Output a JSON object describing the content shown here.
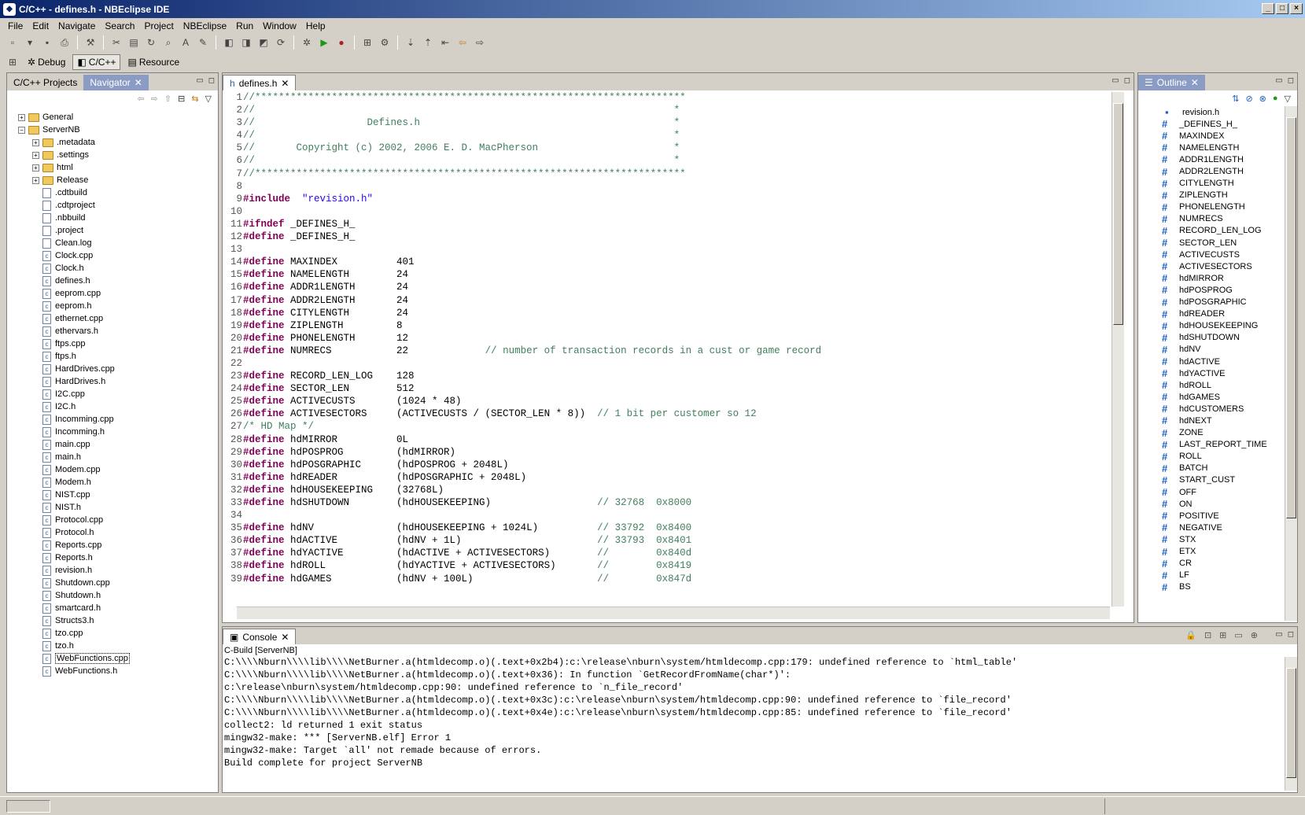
{
  "window": {
    "title": "C/C++ - defines.h - NBEclipse IDE"
  },
  "menu": [
    "File",
    "Edit",
    "Navigate",
    "Search",
    "Project",
    "NBEclipse",
    "Run",
    "Window",
    "Help"
  ],
  "perspectives": [
    {
      "label": "Debug",
      "icon": "bug-icon"
    },
    {
      "label": "C/C++",
      "icon": "cpp-icon",
      "active": true
    },
    {
      "label": "Resource",
      "icon": "folder-icon"
    }
  ],
  "navigator": {
    "tabs": [
      {
        "label": "C/C++ Projects"
      },
      {
        "label": "Navigator",
        "active": true
      }
    ],
    "tree": [
      {
        "label": "General",
        "type": "project",
        "level": 0,
        "expander": "+"
      },
      {
        "label": "ServerNB",
        "type": "project",
        "level": 0,
        "expander": "-"
      },
      {
        "label": ".metadata",
        "type": "folder",
        "level": 1,
        "expander": "+"
      },
      {
        "label": ".settings",
        "type": "folder",
        "level": 1,
        "expander": "+"
      },
      {
        "label": "html",
        "type": "folder",
        "level": 1,
        "expander": "+"
      },
      {
        "label": "Release",
        "type": "folder",
        "level": 1,
        "expander": "+"
      },
      {
        "label": ".cdtbuild",
        "type": "file",
        "level": 1
      },
      {
        "label": ".cdtproject",
        "type": "file",
        "level": 1
      },
      {
        "label": ".nbbuild",
        "type": "file",
        "level": 1
      },
      {
        "label": ".project",
        "type": "file",
        "level": 1
      },
      {
        "label": "Clean.log",
        "type": "file",
        "level": 1
      },
      {
        "label": "Clock.cpp",
        "type": "c",
        "level": 1
      },
      {
        "label": "Clock.h",
        "type": "c",
        "level": 1
      },
      {
        "label": "defines.h",
        "type": "c",
        "level": 1
      },
      {
        "label": "eeprom.cpp",
        "type": "c",
        "level": 1
      },
      {
        "label": "eeprom.h",
        "type": "c",
        "level": 1
      },
      {
        "label": "ethernet.cpp",
        "type": "c",
        "level": 1
      },
      {
        "label": "ethervars.h",
        "type": "c",
        "level": 1
      },
      {
        "label": "ftps.cpp",
        "type": "c",
        "level": 1
      },
      {
        "label": "ftps.h",
        "type": "c",
        "level": 1
      },
      {
        "label": "HardDrives.cpp",
        "type": "c",
        "level": 1
      },
      {
        "label": "HardDrives.h",
        "type": "c",
        "level": 1
      },
      {
        "label": "I2C.cpp",
        "type": "c",
        "level": 1
      },
      {
        "label": "I2C.h",
        "type": "c",
        "level": 1
      },
      {
        "label": "Incomming.cpp",
        "type": "c",
        "level": 1
      },
      {
        "label": "Incomming.h",
        "type": "c",
        "level": 1
      },
      {
        "label": "main.cpp",
        "type": "c",
        "level": 1
      },
      {
        "label": "main.h",
        "type": "c",
        "level": 1
      },
      {
        "label": "Modem.cpp",
        "type": "c",
        "level": 1
      },
      {
        "label": "Modem.h",
        "type": "c",
        "level": 1
      },
      {
        "label": "NIST.cpp",
        "type": "c",
        "level": 1
      },
      {
        "label": "NIST.h",
        "type": "c",
        "level": 1
      },
      {
        "label": "Protocol.cpp",
        "type": "c",
        "level": 1
      },
      {
        "label": "Protocol.h",
        "type": "c",
        "level": 1
      },
      {
        "label": "Reports.cpp",
        "type": "c",
        "level": 1
      },
      {
        "label": "Reports.h",
        "type": "c",
        "level": 1
      },
      {
        "label": "revision.h",
        "type": "c",
        "level": 1
      },
      {
        "label": "Shutdown.cpp",
        "type": "c",
        "level": 1
      },
      {
        "label": "Shutdown.h",
        "type": "c",
        "level": 1
      },
      {
        "label": "smartcard.h",
        "type": "c",
        "level": 1
      },
      {
        "label": "Structs3.h",
        "type": "c",
        "level": 1
      },
      {
        "label": "tzo.cpp",
        "type": "c",
        "level": 1
      },
      {
        "label": "tzo.h",
        "type": "c",
        "level": 1
      },
      {
        "label": "WebFunctions.cpp",
        "type": "c",
        "level": 1,
        "selected": true
      },
      {
        "label": "WebFunctions.h",
        "type": "c",
        "level": 1
      }
    ]
  },
  "editor": {
    "tab": "defines.h",
    "lines": [
      [
        [
          "c-com",
          "//*************************************************************************"
        ]
      ],
      [
        [
          "c-com",
          "//                                                                       *"
        ]
      ],
      [
        [
          "c-com",
          "//                   Defines.h                                           *"
        ]
      ],
      [
        [
          "c-com",
          "//                                                                       *"
        ]
      ],
      [
        [
          "c-com",
          "//       Copyright (c) 2002, 2006 E. D. MacPherson                       *"
        ]
      ],
      [
        [
          "c-com",
          "//                                                                       *"
        ]
      ],
      [
        [
          "c-com",
          "//*************************************************************************"
        ]
      ],
      [],
      [
        [
          "c-kw",
          "#include"
        ],
        [
          "",
          "  "
        ],
        [
          "c-str",
          "\"revision.h\""
        ]
      ],
      [],
      [
        [
          "c-kw",
          "#ifndef"
        ],
        [
          "",
          " _DEFINES_H_"
        ]
      ],
      [
        [
          "c-kw",
          "#define"
        ],
        [
          "",
          " _DEFINES_H_"
        ]
      ],
      [],
      [
        [
          "c-kw",
          "#define"
        ],
        [
          "",
          " MAXINDEX          401"
        ]
      ],
      [
        [
          "c-kw",
          "#define"
        ],
        [
          "",
          " NAMELENGTH        24"
        ]
      ],
      [
        [
          "c-kw",
          "#define"
        ],
        [
          "",
          " ADDR1LENGTH       24"
        ]
      ],
      [
        [
          "c-kw",
          "#define"
        ],
        [
          "",
          " ADDR2LENGTH       24"
        ]
      ],
      [
        [
          "c-kw",
          "#define"
        ],
        [
          "",
          " CITYLENGTH        24"
        ]
      ],
      [
        [
          "c-kw",
          "#define"
        ],
        [
          "",
          " ZIPLENGTH         8"
        ]
      ],
      [
        [
          "c-kw",
          "#define"
        ],
        [
          "",
          " PHONELENGTH       12"
        ]
      ],
      [
        [
          "c-kw",
          "#define"
        ],
        [
          "",
          " NUMRECS           22             "
        ],
        [
          "c-com",
          "// number of transaction records in a cust or game record"
        ]
      ],
      [],
      [
        [
          "c-kw",
          "#define"
        ],
        [
          "",
          " RECORD_LEN_LOG    128"
        ]
      ],
      [
        [
          "c-kw",
          "#define"
        ],
        [
          "",
          " SECTOR_LEN        512"
        ]
      ],
      [
        [
          "c-kw",
          "#define"
        ],
        [
          "",
          " ACTIVECUSTS       (1024 * 48)"
        ]
      ],
      [
        [
          "c-kw",
          "#define"
        ],
        [
          "",
          " ACTIVESECTORS     (ACTIVECUSTS / (SECTOR_LEN * 8))  "
        ],
        [
          "c-com",
          "// 1 bit per customer so 12"
        ]
      ],
      [
        [
          "c-com",
          "/* HD Map */"
        ]
      ],
      [
        [
          "c-kw",
          "#define"
        ],
        [
          "",
          " hdMIRROR          0L"
        ]
      ],
      [
        [
          "c-kw",
          "#define"
        ],
        [
          "",
          " hdPOSPROG         (hdMIRROR)"
        ]
      ],
      [
        [
          "c-kw",
          "#define"
        ],
        [
          "",
          " hdPOSGRAPHIC      (hdPOSPROG + 2048L)"
        ]
      ],
      [
        [
          "c-kw",
          "#define"
        ],
        [
          "",
          " hdREADER          (hdPOSGRAPHIC + 2048L)"
        ]
      ],
      [
        [
          "c-kw",
          "#define"
        ],
        [
          "",
          " hdHOUSEKEEPING    (32768L)"
        ]
      ],
      [
        [
          "c-kw",
          "#define"
        ],
        [
          "",
          " hdSHUTDOWN        (hdHOUSEKEEPING)                  "
        ],
        [
          "c-com",
          "// 32768  0x8000"
        ]
      ],
      [],
      [
        [
          "c-kw",
          "#define"
        ],
        [
          "",
          " hdNV              (hdHOUSEKEEPING + 1024L)          "
        ],
        [
          "c-com",
          "// 33792  0x8400"
        ]
      ],
      [
        [
          "c-kw",
          "#define"
        ],
        [
          "",
          " hdACTIVE          (hdNV + 1L)                       "
        ],
        [
          "c-com",
          "// 33793  0x8401"
        ]
      ],
      [
        [
          "c-kw",
          "#define"
        ],
        [
          "",
          " hdYACTIVE         (hdACTIVE + ACTIVESECTORS)        "
        ],
        [
          "c-com",
          "//        0x840d"
        ]
      ],
      [
        [
          "c-kw",
          "#define"
        ],
        [
          "",
          " hdROLL            (hdYACTIVE + ACTIVESECTORS)       "
        ],
        [
          "c-com",
          "//        0x8419"
        ]
      ],
      [
        [
          "c-kw",
          "#define"
        ],
        [
          "",
          " hdGAMES           (hdNV + 100L)                     "
        ],
        [
          "c-com",
          "//        0x847d"
        ]
      ]
    ]
  },
  "outline": {
    "tab": "Outline",
    "items": [
      {
        "label": "revision.h",
        "kind": "include"
      },
      {
        "label": "_DEFINES_H_",
        "kind": "macro"
      },
      {
        "label": "MAXINDEX",
        "kind": "macro"
      },
      {
        "label": "NAMELENGTH",
        "kind": "macro"
      },
      {
        "label": "ADDR1LENGTH",
        "kind": "macro"
      },
      {
        "label": "ADDR2LENGTH",
        "kind": "macro"
      },
      {
        "label": "CITYLENGTH",
        "kind": "macro"
      },
      {
        "label": "ZIPLENGTH",
        "kind": "macro"
      },
      {
        "label": "PHONELENGTH",
        "kind": "macro"
      },
      {
        "label": "NUMRECS",
        "kind": "macro"
      },
      {
        "label": "RECORD_LEN_LOG",
        "kind": "macro"
      },
      {
        "label": "SECTOR_LEN",
        "kind": "macro"
      },
      {
        "label": "ACTIVECUSTS",
        "kind": "macro"
      },
      {
        "label": "ACTIVESECTORS",
        "kind": "macro"
      },
      {
        "label": "hdMIRROR",
        "kind": "macro"
      },
      {
        "label": "hdPOSPROG",
        "kind": "macro"
      },
      {
        "label": "hdPOSGRAPHIC",
        "kind": "macro"
      },
      {
        "label": "hdREADER",
        "kind": "macro"
      },
      {
        "label": "hdHOUSEKEEPING",
        "kind": "macro"
      },
      {
        "label": "hdSHUTDOWN",
        "kind": "macro"
      },
      {
        "label": "hdNV",
        "kind": "macro"
      },
      {
        "label": "hdACTIVE",
        "kind": "macro"
      },
      {
        "label": "hdYACTIVE",
        "kind": "macro"
      },
      {
        "label": "hdROLL",
        "kind": "macro"
      },
      {
        "label": "hdGAMES",
        "kind": "macro"
      },
      {
        "label": "hdCUSTOMERS",
        "kind": "macro"
      },
      {
        "label": "hdNEXT",
        "kind": "macro"
      },
      {
        "label": "ZONE",
        "kind": "macro"
      },
      {
        "label": "LAST_REPORT_TIME",
        "kind": "macro"
      },
      {
        "label": "ROLL",
        "kind": "macro"
      },
      {
        "label": "BATCH",
        "kind": "macro"
      },
      {
        "label": "START_CUST",
        "kind": "macro"
      },
      {
        "label": "OFF",
        "kind": "macro"
      },
      {
        "label": "ON",
        "kind": "macro"
      },
      {
        "label": "POSITIVE",
        "kind": "macro"
      },
      {
        "label": "NEGATIVE",
        "kind": "macro"
      },
      {
        "label": "STX",
        "kind": "macro"
      },
      {
        "label": "ETX",
        "kind": "macro"
      },
      {
        "label": "CR",
        "kind": "macro"
      },
      {
        "label": "LF",
        "kind": "macro"
      },
      {
        "label": "BS",
        "kind": "macro"
      }
    ]
  },
  "console": {
    "tab": "Console",
    "subtitle": "C-Build [ServerNB]",
    "lines": [
      "C:\\\\\\\\Nburn\\\\\\\\lib\\\\\\\\NetBurner.a(htmldecomp.o)(.text+0x2b4):c:\\release\\nburn\\system/htmldecomp.cpp:179: undefined reference to `html_table'",
      "C:\\\\\\\\Nburn\\\\\\\\lib\\\\\\\\NetBurner.a(htmldecomp.o)(.text+0x36): In function `GetRecordFromName(char*)':",
      "c:\\release\\nburn\\system/htmldecomp.cpp:90: undefined reference to `n_file_record'",
      "C:\\\\\\\\Nburn\\\\\\\\lib\\\\\\\\NetBurner.a(htmldecomp.o)(.text+0x3c):c:\\release\\nburn\\system/htmldecomp.cpp:90: undefined reference to `file_record'",
      "C:\\\\\\\\Nburn\\\\\\\\lib\\\\\\\\NetBurner.a(htmldecomp.o)(.text+0x4e):c:\\release\\nburn\\system/htmldecomp.cpp:85: undefined reference to `file_record'",
      "collect2: ld returned 1 exit status",
      "mingw32-make: *** [ServerNB.elf] Error 1",
      "mingw32-make: Target `all' not remade because of errors.",
      "Build complete for project ServerNB"
    ]
  }
}
